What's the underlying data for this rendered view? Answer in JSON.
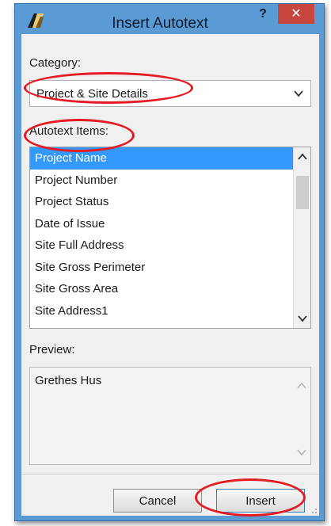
{
  "window": {
    "title": "Insert Autotext",
    "help_label": "?",
    "close_label": "✕"
  },
  "category": {
    "label": "Category:",
    "selected": "Project & Site Details"
  },
  "autotext": {
    "label": "Autotext Items:",
    "items": [
      "Project Name",
      "Project Number",
      "Project Status",
      "Date of Issue",
      "Site Full Address",
      "Site Gross Perimeter",
      "Site Gross Area",
      "Site Address1"
    ],
    "selected_index": 0
  },
  "preview": {
    "label": "Preview:",
    "text": "Grethes Hus"
  },
  "buttons": {
    "cancel": "Cancel",
    "insert": "Insert"
  },
  "colors": {
    "titlebar": "#5a9bd6",
    "close": "#c7473f",
    "selection": "#3399ff",
    "annotation": "#e41b23"
  }
}
